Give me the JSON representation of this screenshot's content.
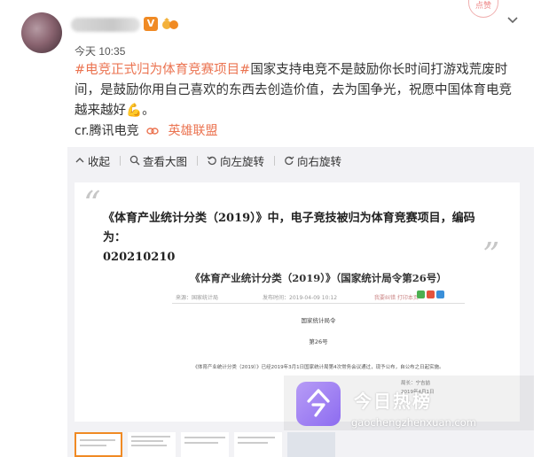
{
  "post": {
    "time": "今天 10:35",
    "vip_badge": "V",
    "stamp": "点赞",
    "text_hashtag": "#电竞正式归为体育竞赛项目#",
    "text_body": "国家支持电竞不是鼓励你长时间打游戏荒废时间，是鼓励你用自己喜欢的东西去创造价值，去为国争光，祝愿中国体育电竞越来越好",
    "text_emoji": "💪",
    "text_end": "。",
    "source_label": "cr.腾讯电竞",
    "source_link": "英雄联盟"
  },
  "toolbar": {
    "items": [
      {
        "label": "收起",
        "icon": "collapse-icon"
      },
      {
        "label": "查看大图",
        "icon": "zoom-icon"
      },
      {
        "label": "向左旋转",
        "icon": "rotate-left-icon"
      },
      {
        "label": "向右旋转",
        "icon": "rotate-right-icon"
      }
    ]
  },
  "image": {
    "quote_text": "《体育产业统计分类（2019）》中，电子竞技被归为体育竞赛项目，编码为：",
    "code": "020210210",
    "inner_title": "《体育产业统计分类（2019）》（国家统计局令第26号）",
    "inner_meta_source": "来源：国家统计局",
    "inner_meta_time": "发布时间：2019-04-09  10:12",
    "inner_meta_tools": "我要纠错  打印本页",
    "inner_heading": "国家统计局令",
    "inner_number": "第26号",
    "inner_body": "《体育产业统计分类（2019）》已经2019年3月1日国家统计局第4次常务会议通过，现予公布，自公布之日起实施。",
    "inner_sign": "局长：宁吉喆",
    "inner_date": "2019年4月1日"
  },
  "watermark": {
    "brand": "今日热榜",
    "url": "gaochengzhenxuan.com"
  },
  "colors": {
    "accent": "#eb7350",
    "active_thumb": "#f08a24",
    "watermark_logo": "#9b7cf3"
  }
}
